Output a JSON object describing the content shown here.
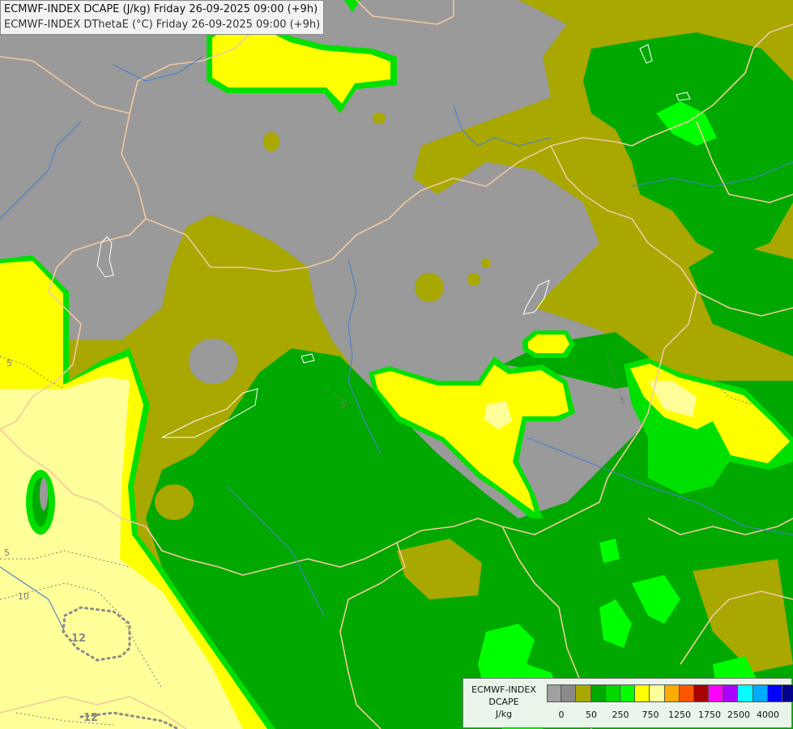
{
  "title": {
    "line1": "ECMWF-INDEX DCAPE (J/kg) Friday 26-09-2025 09:00 (+9h)",
    "line2": "ECMWF-INDEX DThetaE (°C) Friday 26-09-2025 09:00 (+9h)"
  },
  "legend": {
    "name_line1": "ECMWF-INDEX",
    "name_line2": "DCAPE",
    "unit": "J/kg",
    "colors": [
      "#a0a0a0",
      "#8a8a8a",
      "#a8a800",
      "#00a800",
      "#00d800",
      "#00ff00",
      "#ffff00",
      "#ffff99",
      "#ffaa00",
      "#ff5500",
      "#aa0000",
      "#ff00ff",
      "#aa00ff",
      "#00ffff",
      "#00aaff",
      "#0000ff",
      "#000088"
    ],
    "tick_labels": [
      "0",
      "50",
      "250",
      "750",
      "1250",
      "1750",
      "2500",
      "4000"
    ]
  },
  "isolines": {
    "labels": [
      "5",
      "5",
      "5",
      "5",
      "10",
      "12",
      "12"
    ]
  },
  "colors": {
    "grey": "#9a9a9a",
    "olive": "#a8a800",
    "green": "#00a800",
    "lime": "#00e000",
    "bright_green": "#00ff00",
    "yellow": "#ffff00",
    "light_yellow": "#ffff99",
    "border": "#f2c9a0",
    "river": "#4a7fd0"
  }
}
